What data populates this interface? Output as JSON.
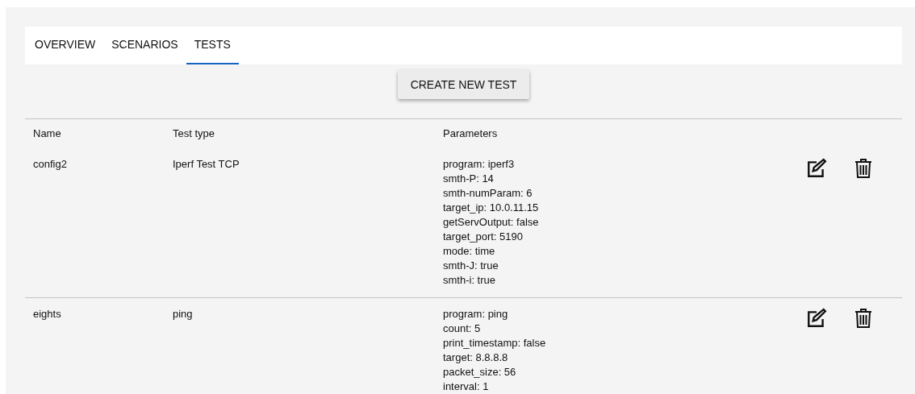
{
  "tabs": [
    {
      "label": "OVERVIEW",
      "selected": false
    },
    {
      "label": "SCENARIOS",
      "selected": false
    },
    {
      "label": "TESTS",
      "selected": true
    }
  ],
  "create_button": "CREATE NEW TEST",
  "table": {
    "columns": [
      "Name",
      "Test type",
      "Parameters"
    ],
    "rows": [
      {
        "name": "config2",
        "test_type": "Iperf Test TCP",
        "parameters": [
          "program: iperf3",
          "smth-P: 14",
          "smth-numParam: 6",
          "target_ip: 10.0.11.15",
          "getServOutput: false",
          "target_port: 5190",
          "mode: time",
          "smth-J: true",
          "smth-i: true"
        ]
      },
      {
        "name": "eights",
        "test_type": "ping",
        "parameters": [
          "program: ping",
          "count: 5",
          "print_timestamp: false",
          "target: 8.8.8.8",
          "packet_size: 56",
          "interval: 1"
        ]
      }
    ]
  }
}
